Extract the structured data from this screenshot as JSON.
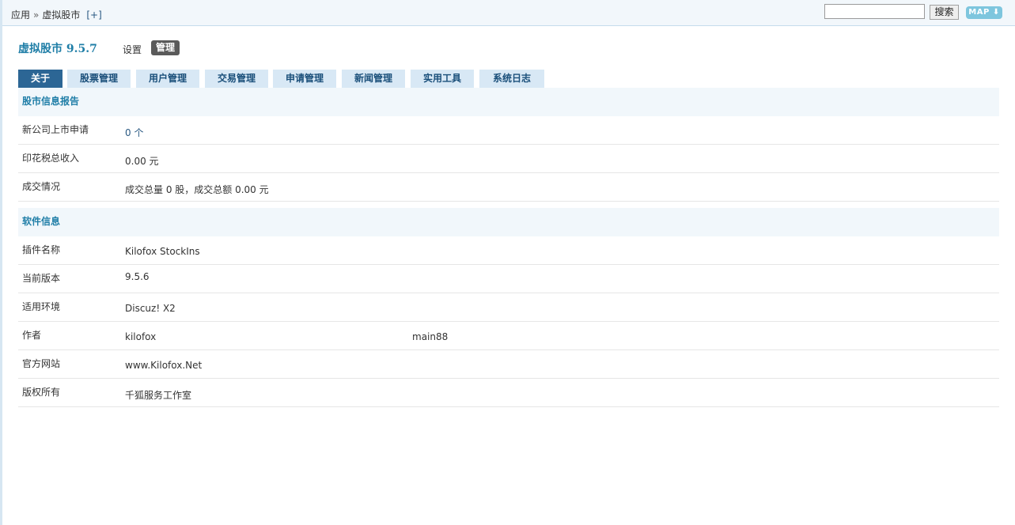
{
  "breadcrumb": {
    "root": "应用",
    "sep": "»",
    "current": "虚拟股市",
    "add": "[+]"
  },
  "search": {
    "value": "",
    "button": "搜索"
  },
  "map_button": "MAP",
  "title": {
    "app": "虚拟股市 9.5.7",
    "settings": "设置",
    "manage": "管理"
  },
  "tabs": [
    {
      "label": "关于",
      "active": true
    },
    {
      "label": "股票管理"
    },
    {
      "label": "用户管理"
    },
    {
      "label": "交易管理"
    },
    {
      "label": "申请管理"
    },
    {
      "label": "新闻管理"
    },
    {
      "label": "实用工具"
    },
    {
      "label": "系统日志"
    }
  ],
  "report": {
    "heading": "股市信息报告",
    "rows": [
      {
        "label": "新公司上市申请",
        "value": "0 个"
      },
      {
        "label": "印花税总收入",
        "value": "0.00 元"
      },
      {
        "label": "成交情况",
        "value": "成交总量 0 股，成交总额 0.00 元"
      }
    ]
  },
  "software": {
    "heading": "软件信息",
    "rows": [
      {
        "label": "插件名称",
        "value": "Kilofox StockIns"
      },
      {
        "label": "当前版本",
        "value": "9.5.6"
      },
      {
        "label": "适用环境",
        "value": "Discuz! X2"
      },
      {
        "label": "作者",
        "value": "kilofox",
        "value2": "main88"
      },
      {
        "label": "官方网站",
        "value": "www.Kilofox.Net"
      },
      {
        "label": "版权所有",
        "value": "千狐服务工作室"
      }
    ]
  },
  "colors": {
    "accent": "#1f7ea7",
    "tab_active": "#2c6695",
    "tab": "#d8e8f5",
    "section_bg": "#f1f7fb"
  }
}
